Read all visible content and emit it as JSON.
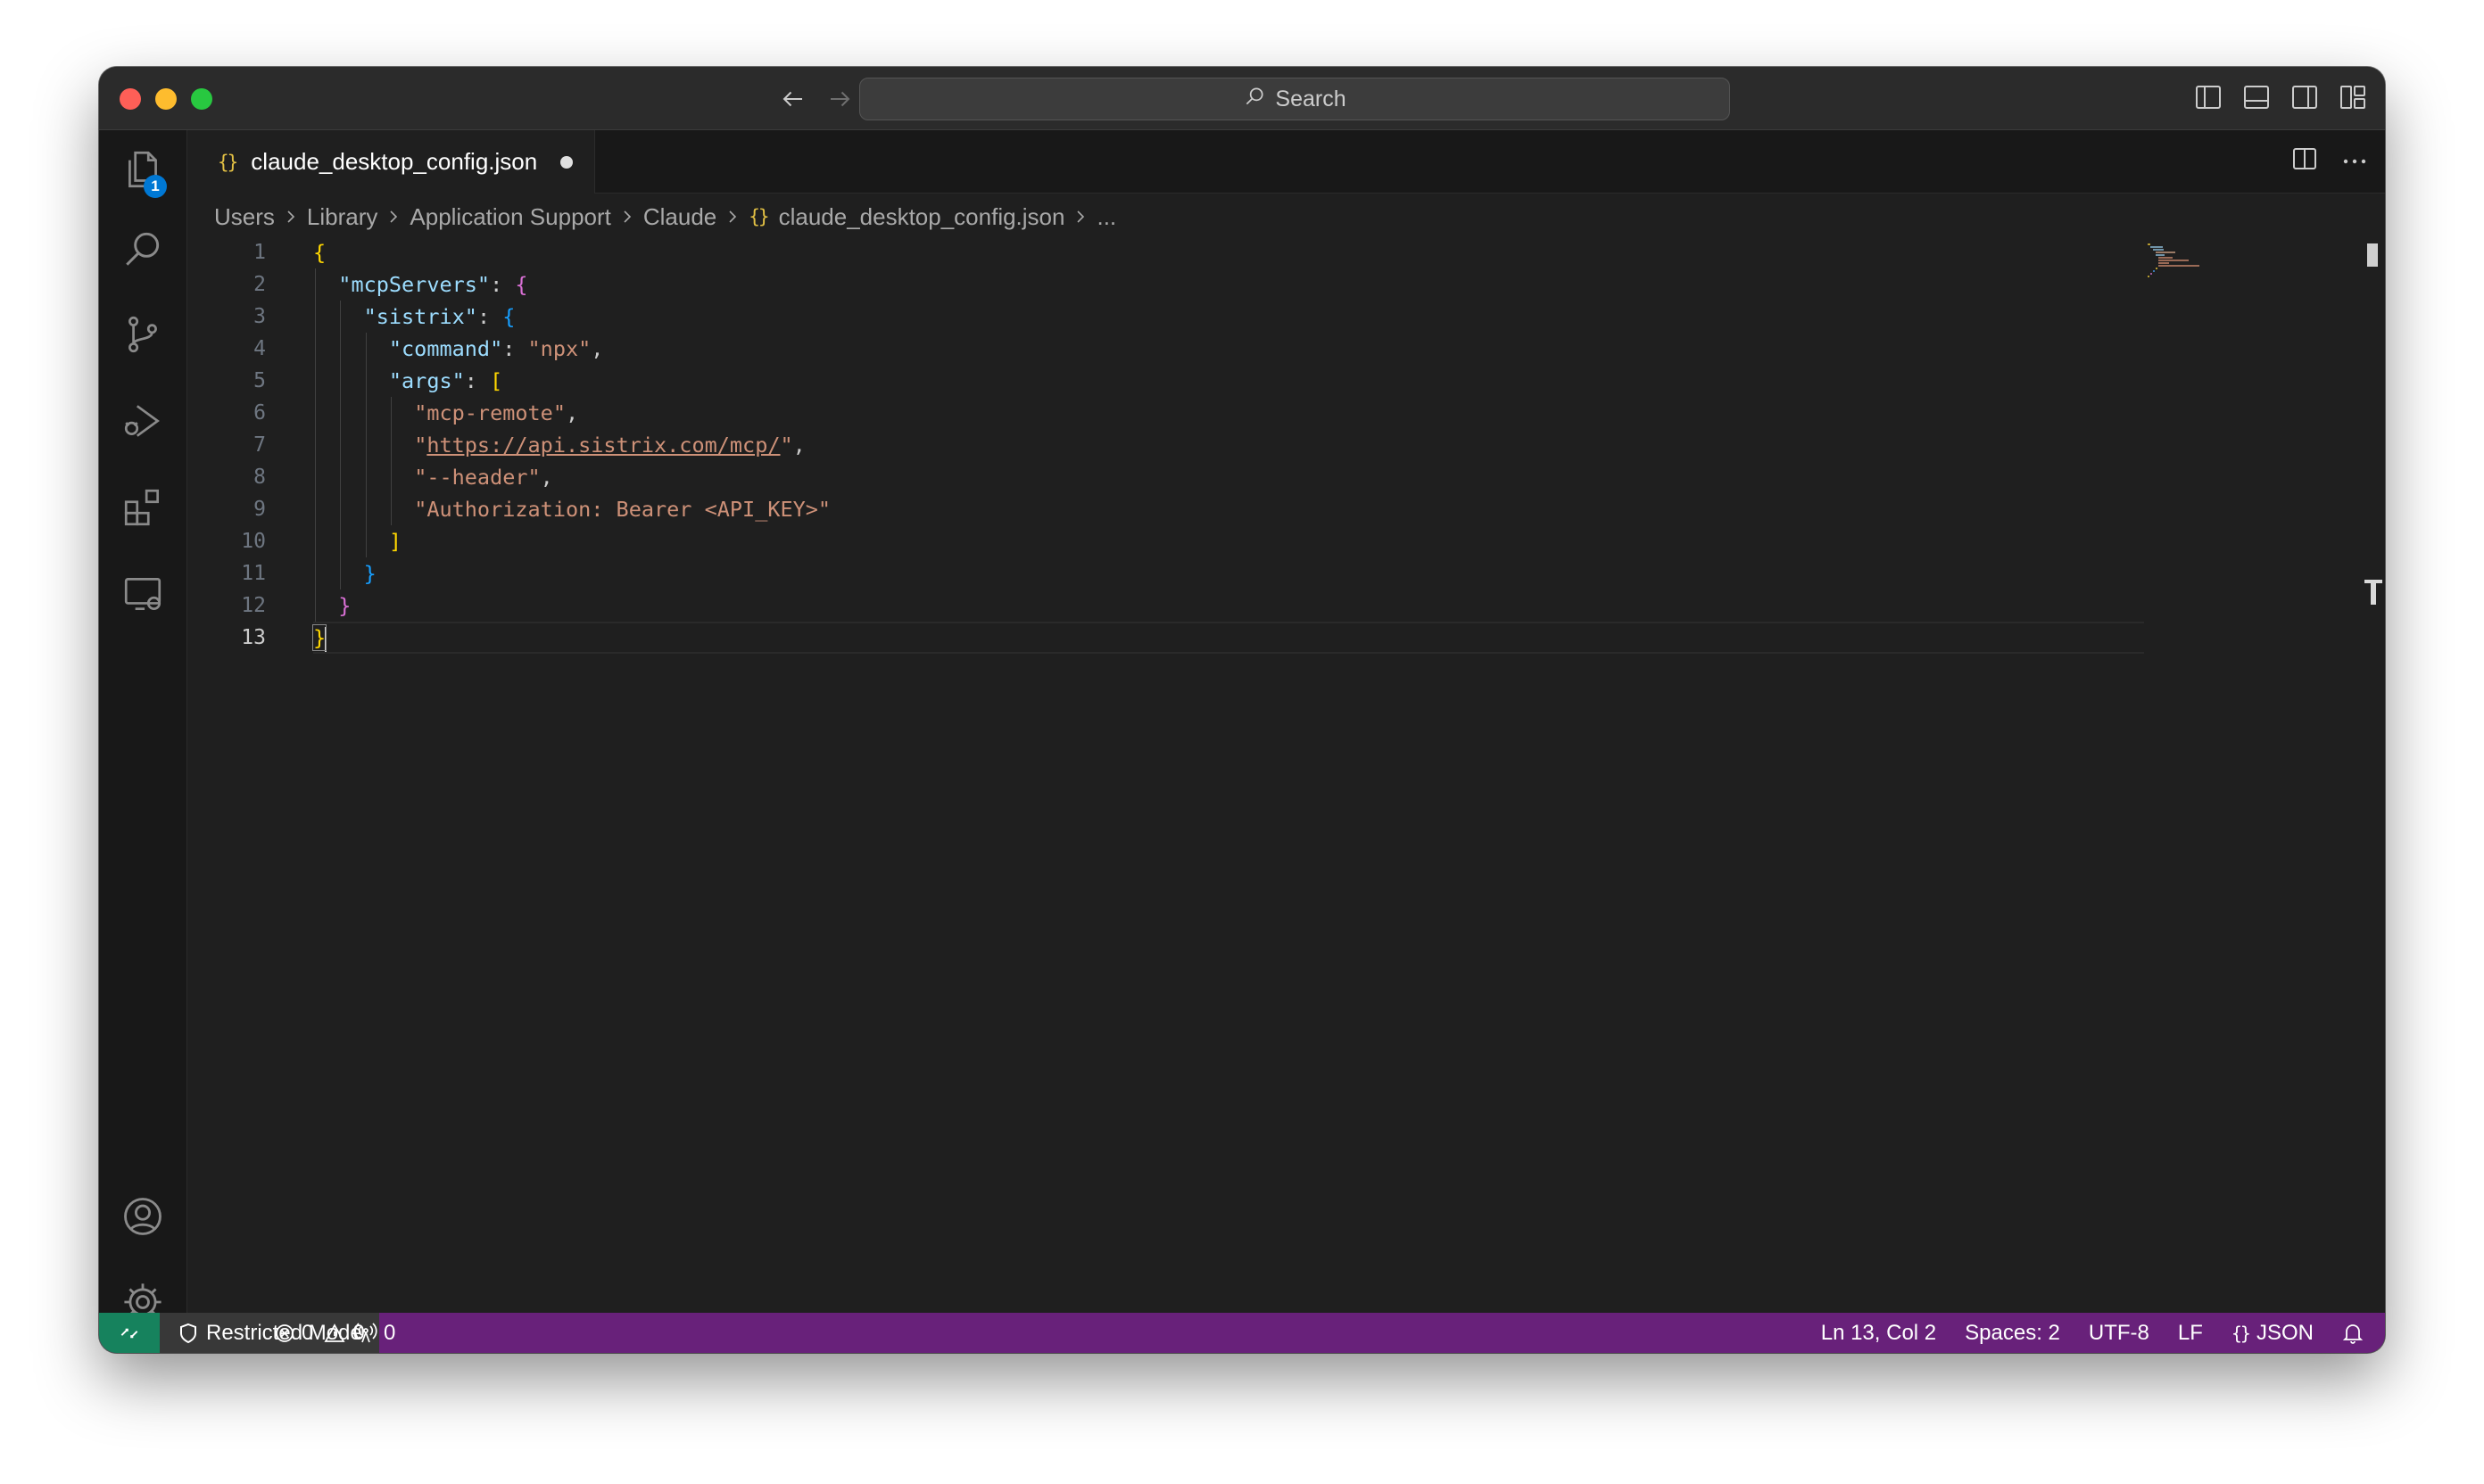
{
  "titlebar": {
    "search_placeholder": "Search",
    "icons": [
      "back-arrow-icon",
      "forward-arrow-icon",
      "search-icon",
      "toggle-primary-sidebar-icon",
      "toggle-panel-icon",
      "toggle-secondary-sidebar-icon",
      "customize-layout-icon"
    ]
  },
  "activity_bar": {
    "explorer_badge": "1",
    "icons": [
      "explorer-icon",
      "search-icon",
      "source-control-icon",
      "run-debug-icon",
      "extensions-icon",
      "remote-explorer-icon",
      "accounts-icon",
      "manage-gear-icon"
    ]
  },
  "tab": {
    "icon_glyph": "{}",
    "filename": "claude_desktop_config.json",
    "modified": true
  },
  "breadcrumb": {
    "items": [
      "Users",
      "Library",
      "Application Support",
      "Claude"
    ],
    "file_icon": "{}",
    "file": "claude_desktop_config.json",
    "trailing": "..."
  },
  "editor": {
    "line_numbers": [
      "1",
      "2",
      "3",
      "4",
      "5",
      "6",
      "7",
      "8",
      "9",
      "10",
      "11",
      "12",
      "13"
    ],
    "current_line": 13,
    "tokens": {
      "open_brace": "{",
      "mcp_servers_key": "\"mcpServers\"",
      "sistrix_key": "\"sistrix\"",
      "command_key": "\"command\"",
      "command_value": "\"npx\"",
      "args_key": "\"args\"",
      "arg1": "\"mcp-remote\"",
      "arg2_url": "https://api.sistrix.com/mcp/",
      "arg3": "\"--header\"",
      "arg4": "\"Authorization: Bearer <API_KEY>\"",
      "close_bracket": "]",
      "close_brace": "}"
    }
  },
  "statusbar": {
    "restricted_mode": "Restricted Mode",
    "errors": "0",
    "warnings": "0",
    "ports": "0",
    "cursor_position": "Ln 13, Col 2",
    "indentation": "Spaces: 2",
    "encoding": "UTF-8",
    "eol": "LF",
    "language_icon": "{}",
    "language": "JSON",
    "colors": {
      "background": "#68217a",
      "remote": "#16825d"
    }
  }
}
